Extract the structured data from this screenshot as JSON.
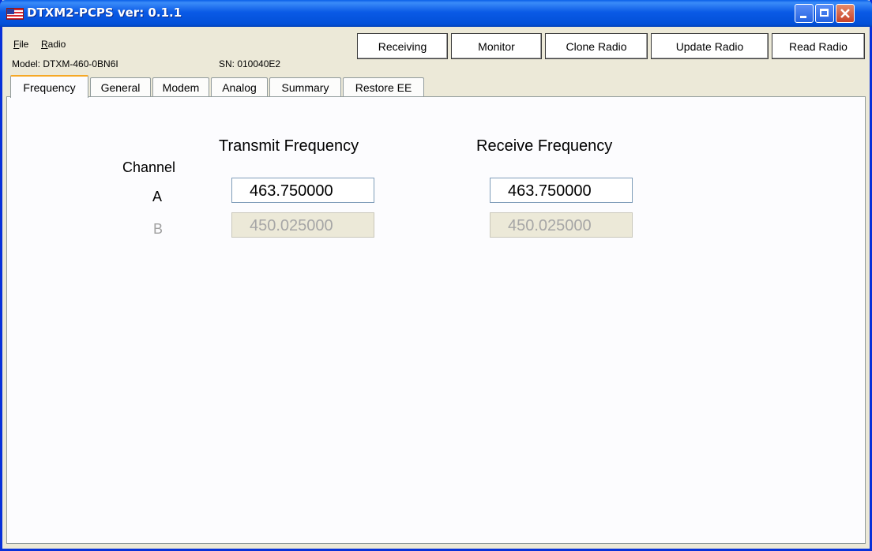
{
  "window": {
    "title": "DTXM2-PCPS ver: 0.1.1"
  },
  "menu": {
    "file_label": "File",
    "file_mnemonic": "F",
    "file_rest": "ile",
    "radio_label": "Radio",
    "radio_mnemonic": "R",
    "radio_rest": "adio"
  },
  "info": {
    "model": "Model: DTXM-460-0BN6I",
    "serial": "SN: 010040E2"
  },
  "toolbar": {
    "receiving": "Receiving",
    "monitor": "Monitor",
    "clone_radio": "Clone Radio",
    "update_radio": "Update Radio",
    "read_radio": "Read Radio"
  },
  "tabs": [
    {
      "label": "Frequency",
      "active": true
    },
    {
      "label": "General",
      "active": false
    },
    {
      "label": "Modem",
      "active": false
    },
    {
      "label": "Analog",
      "active": false
    },
    {
      "label": "Summary",
      "active": false
    },
    {
      "label": "Restore EE",
      "active": false
    }
  ],
  "frequency": {
    "transmit_heading": "Transmit Frequency",
    "receive_heading": "Receive Frequency",
    "channel_label": "Channel",
    "channels": [
      {
        "name": "A",
        "transmit": "463.750000",
        "receive": "463.750000",
        "enabled": true
      },
      {
        "name": "B",
        "transmit": "450.025000",
        "receive": "450.025000",
        "enabled": false
      }
    ]
  },
  "colors": {
    "titlebar": "#0a5ae6",
    "face": "#ece9d8",
    "tab_active_accent": "#f6a825"
  }
}
